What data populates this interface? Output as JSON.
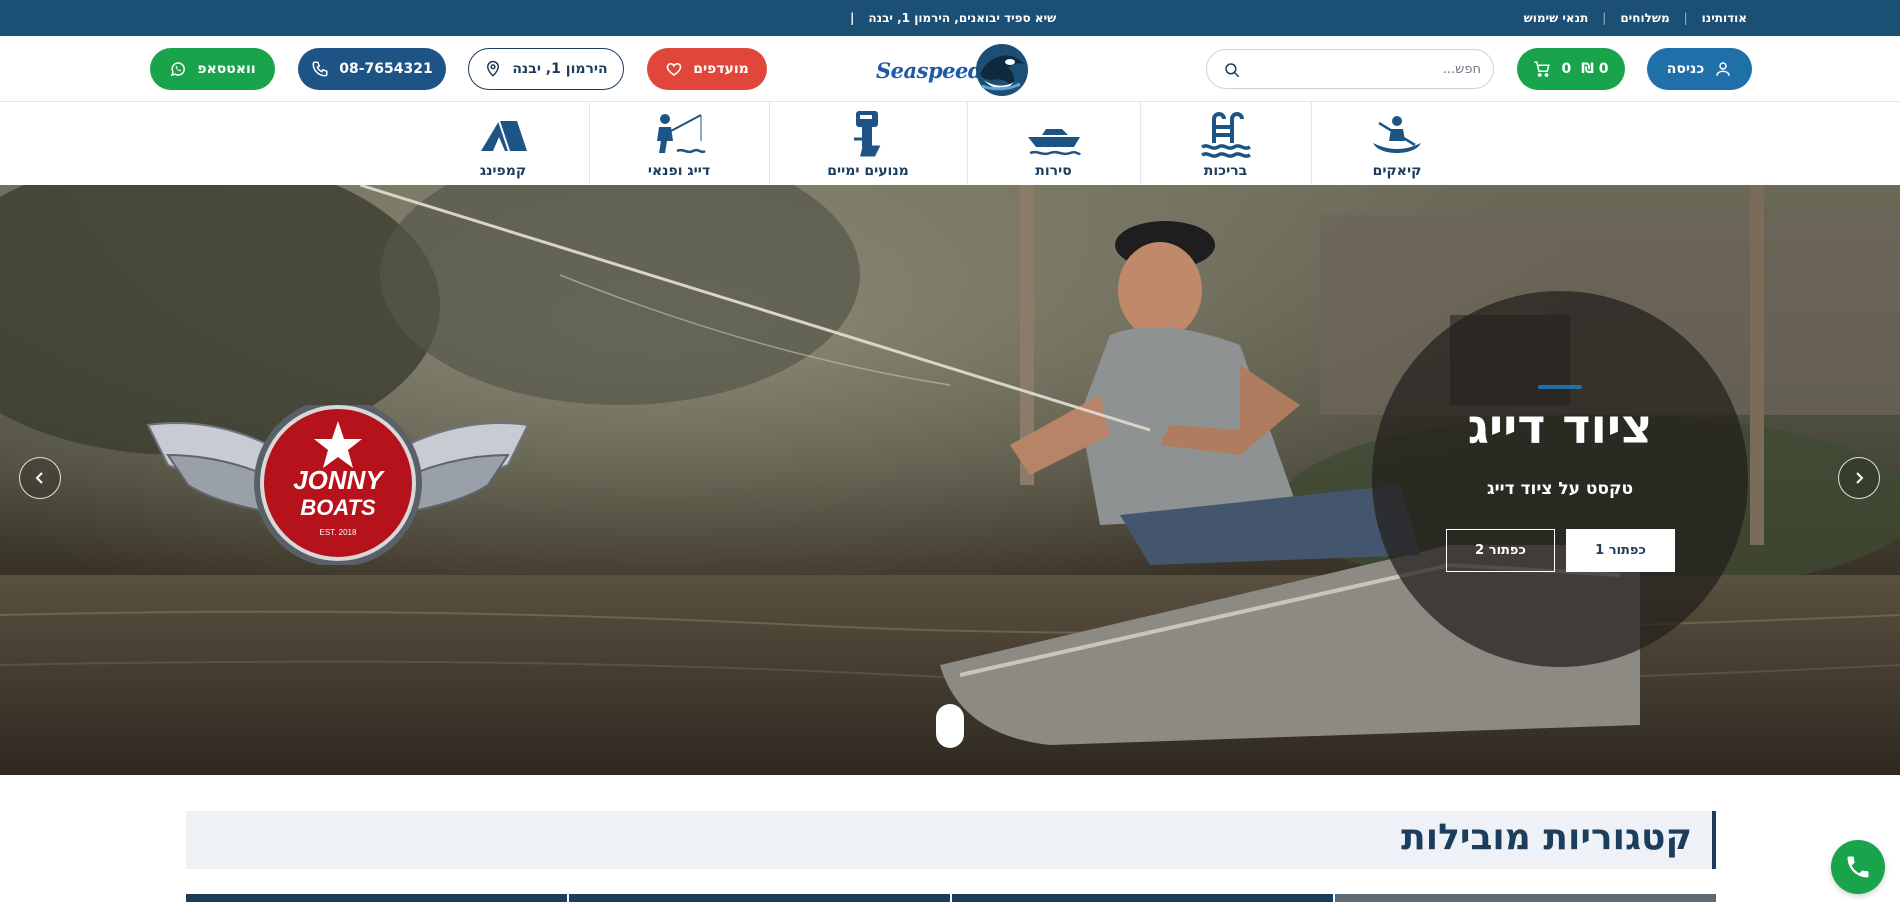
{
  "topbar": {
    "links": [
      "אודותינו",
      "משלוחים",
      "תנאי שימוש"
    ],
    "announcement": "שיא ספיד יבואנים, הירמון 1, יבנה"
  },
  "header": {
    "login_label": "כניסה",
    "cart_count": "0",
    "cart_total": "0 ₪",
    "search_placeholder": "חפש...",
    "logo_text": "Seaspeed",
    "favorites_label": "מועדפים",
    "address_label": "הירמון 1, יבנה",
    "phone_label": "08-7654321",
    "whatsapp_label": "וואטסאפ"
  },
  "categories": [
    {
      "label": "קיאקים",
      "icon": "kayak-icon"
    },
    {
      "label": "בריכות",
      "icon": "pool-ladder-icon"
    },
    {
      "label": "סירות",
      "icon": "boat-icon"
    },
    {
      "label": "מנועים ימיים",
      "icon": "outboard-motor-icon"
    },
    {
      "label": "דייג ופנאי",
      "icon": "fisherman-icon"
    },
    {
      "label": "קמפינג",
      "icon": "tent-icon"
    }
  ],
  "hero": {
    "title": "ציוד דייג",
    "subtitle": "טקסט על ציוד דייג",
    "button1": "כפתור 1",
    "button2": "כפתור 2",
    "badge_line1": "JONNY",
    "badge_line2": "BOATS",
    "badge_est": "EST. 2018"
  },
  "section": {
    "title": "קטגוריות מובילות"
  },
  "colors": {
    "primary": "#1d3d5c",
    "topbar": "#1b4f73",
    "accent_blue": "#1f6fa8",
    "green": "#19a34a",
    "red": "#e0463a"
  }
}
